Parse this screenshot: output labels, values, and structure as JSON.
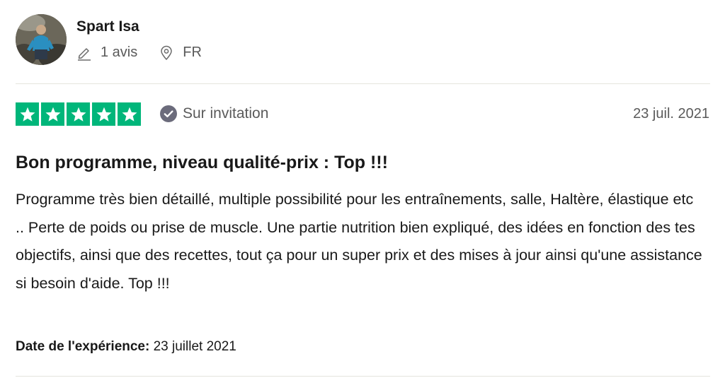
{
  "reviewer": {
    "name": "Spart Isa",
    "review_count": "1 avis",
    "country": "FR"
  },
  "rating": {
    "stars": 5,
    "max": 5
  },
  "verification_label": "Sur invitation",
  "review_date": "23 juil. 2021",
  "review": {
    "title": "Bon programme, niveau qualité-prix : Top !!!",
    "body": "Programme très bien détaillé, multiple possibilité pour les entraînements, salle, Haltère, élastique etc .. Perte de poids ou prise de muscle. Une partie nutrition bien expliqué, des idées en fonction des tes objectifs, ainsi que des recettes, tout ça pour un super prix et des mises à jour ainsi qu'une assistance si besoin d'aide. Top !!!"
  },
  "experience": {
    "label": "Date de l'expérience:",
    "value": "23 juillet 2021"
  },
  "colors": {
    "star_green": "#00b67a",
    "text_primary": "#191919",
    "text_secondary": "#5a5a5a",
    "divider": "#e5e5dd"
  }
}
